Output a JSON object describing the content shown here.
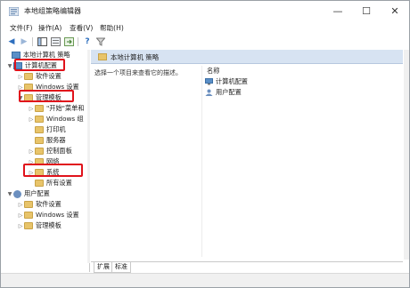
{
  "window": {
    "title": "本地组策略编辑器",
    "controls": {
      "minimize": "—",
      "maximize": "☐",
      "close": "✕"
    }
  },
  "menu": [
    "文件(F)",
    "操作(A)",
    "查看(V)",
    "帮助(H)"
  ],
  "tree": {
    "root": "本地计算机 策略",
    "computer_config": "计算机配置",
    "software_settings_1": "软件设置",
    "windows_settings_1": "Windows 设置",
    "admin_templates_1": "管理模板",
    "start_menu": "\"开始\"菜单和",
    "windows_components": "Windows 组",
    "printers": "打印机",
    "server": "服务器",
    "control_panel": "控制面板",
    "network": "网络",
    "system": "系统",
    "all_settings": "所有设置",
    "user_config": "用户配置",
    "software_settings_2": "软件设置",
    "windows_settings_2": "Windows 设置",
    "admin_templates_2": "管理模板"
  },
  "right": {
    "header": "本地计算机 策略",
    "description": "选择一个项目来查看它的描述。",
    "column_name": "名称",
    "items": [
      "计算机配置",
      "用户配置"
    ]
  },
  "tabs": [
    "扩展",
    "标准"
  ],
  "colors": {
    "highlight": "#e0121b",
    "header_bg": "#d7e3f2",
    "folder": "#e8c46a"
  }
}
